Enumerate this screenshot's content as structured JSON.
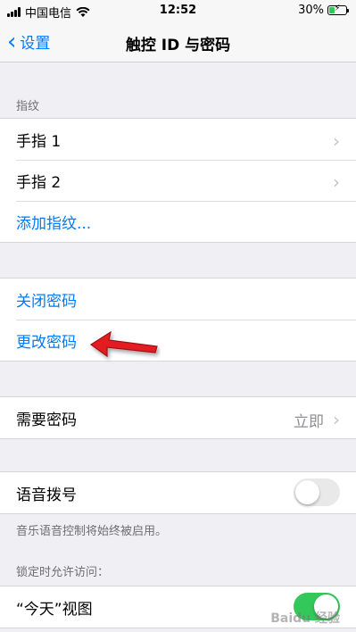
{
  "status": {
    "carrier": "中国电信",
    "time": "12:52",
    "battery": "30%"
  },
  "nav": {
    "back_label": "设置",
    "title": "触控 ID 与密码"
  },
  "fingerprints": {
    "header": "指纹",
    "items": [
      {
        "label": "手指 1"
      },
      {
        "label": "手指 2"
      }
    ],
    "add_label": "添加指纹..."
  },
  "passcode": {
    "turn_off": "关闭密码",
    "change": "更改密码"
  },
  "require": {
    "label": "需要密码",
    "value": "立即"
  },
  "voice_dial": {
    "label": "语音拨号",
    "enabled": false,
    "note": "音乐语音控制将始终被启用。"
  },
  "lock_access": {
    "header": "锁定时允许访问：",
    "today_view": {
      "label": "“今天”视图",
      "enabled": true
    }
  },
  "watermark": "Baidu 经验",
  "colors": {
    "accent": "#007aff",
    "toggle_on": "#34c759",
    "annotation_arrow": "#e31e24"
  },
  "icons": [
    "signal-icon",
    "wifi-icon",
    "battery-icon",
    "chevron-left-icon",
    "chevron-right-icon",
    "red-arrow-icon"
  ]
}
